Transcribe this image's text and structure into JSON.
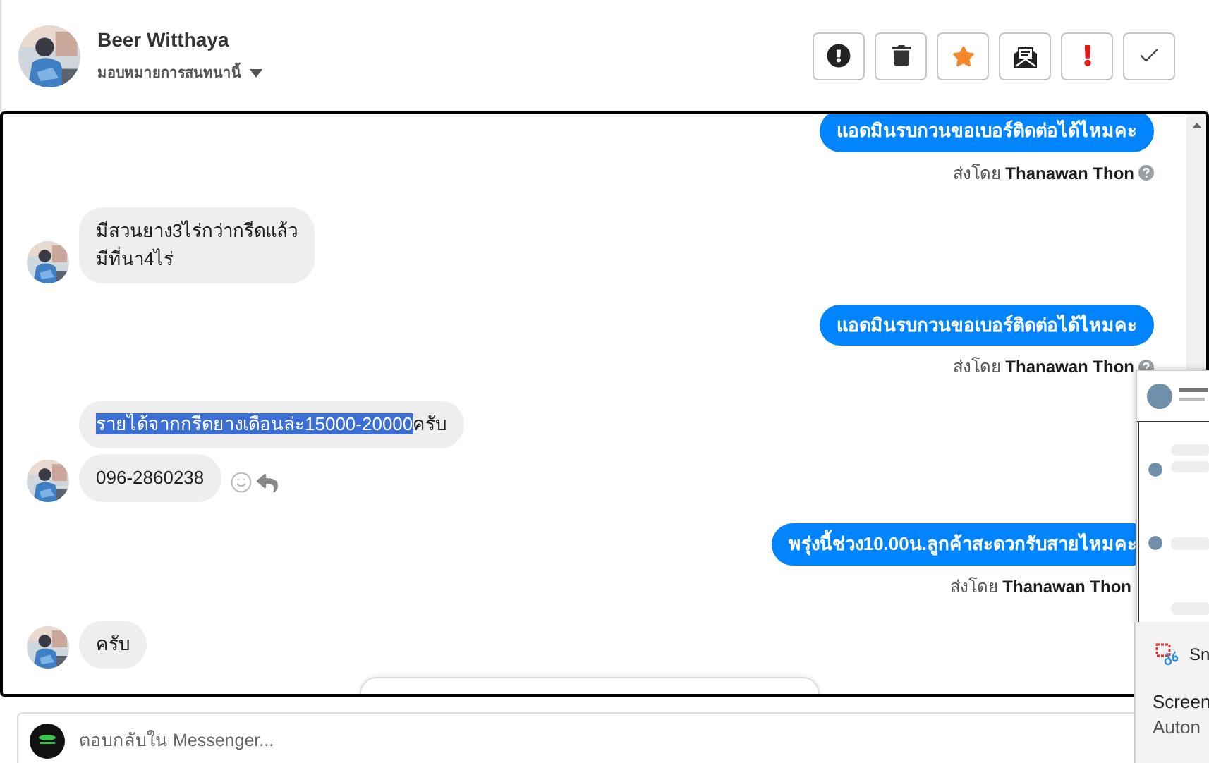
{
  "header": {
    "name": "Beer Witthaya",
    "assign_label": "มอบหมายการสนทนานี้",
    "actions": [
      {
        "kind": "alert"
      },
      {
        "kind": "trash"
      },
      {
        "kind": "star"
      },
      {
        "kind": "envelope"
      },
      {
        "kind": "exclaim"
      },
      {
        "kind": "check"
      }
    ]
  },
  "messages": [
    {
      "kind": "outgoing",
      "text": "แอดมินรบกวนขอเบอร์ติดต่อได้ไหมคะ",
      "sent_by": "ส่งโดย",
      "sender": "Thanawan Thon",
      "help_icon": true
    },
    {
      "kind": "incoming",
      "bubbles": [
        {
          "lines": [
            "มีสวนยาง3ไร่กว่ากรีดแล้ว",
            "มีที่นา4ไร่"
          ],
          "show_actions": false
        }
      ]
    },
    {
      "kind": "outgoing",
      "text": "แอดมินรบกวนขอเบอร์ติดต่อได้ไหมคะ",
      "sent_by": "ส่งโดย",
      "sender": "Thanawan Thon",
      "help_icon": true
    },
    {
      "kind": "incoming",
      "bubbles": [
        {
          "parts": [
            {
              "text": "รายได้จากกรีดยางเดือนล่ะ15000-20000",
              "selected": true
            },
            {
              "text": "ครับ",
              "selected": false
            }
          ],
          "show_actions": false
        },
        {
          "lines": [
            "096-2860238"
          ],
          "show_actions": true
        }
      ]
    },
    {
      "kind": "outgoing",
      "text": "พรุ่งนี้ช่วง10.00น.ลูกค้าสะดวกรับสายไหมคะ",
      "sent_by": "ส่งโดย",
      "sender": "Thanawan Thon",
      "help_icon": false
    },
    {
      "kind": "incoming",
      "bubbles": [
        {
          "lines": [
            "ครับ"
          ],
          "show_actions": false
        }
      ]
    }
  ],
  "composer": {
    "placeholder": "ตอบกลับใน Messenger..."
  },
  "snip_toast": {
    "app": "Sn",
    "lines": [
      "Screen",
      "Auton"
    ]
  }
}
